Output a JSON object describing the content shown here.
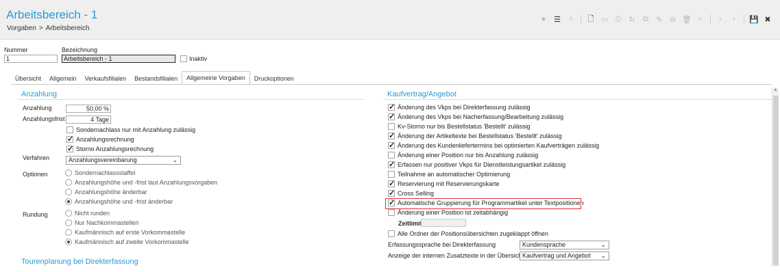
{
  "window": {
    "title": "Arbeitsbereich - 1"
  },
  "breadcrumb": [
    "Vorgaben",
    "Arbeitsbereich"
  ],
  "breadcrumb_sep": ">",
  "toolbar": {
    "icons": [
      "comment-icon",
      "list-icon",
      "pin-icon",
      "new-document-icon",
      "folder-icon",
      "print-icon",
      "refresh-icon",
      "copy-icon",
      "attach-icon",
      "stop-icon",
      "delete-icon",
      "search-icon",
      "prev-icon",
      "next-icon",
      "save-icon",
      "close-icon"
    ],
    "glyphs": [
      "●",
      "☰",
      "♀",
      "🗋",
      "▭",
      "⎙",
      "↻",
      "⧉",
      "✎",
      "⊖",
      "🗑",
      "⌕",
      "‹",
      "›",
      "💾",
      "✖"
    ]
  },
  "header_fields": {
    "nummer_label": "Nummer",
    "nummer_value": "1",
    "bezeichnung_label": "Bezeichnung",
    "bezeichnung_value": "Arbeitsbereich - 1",
    "inaktiv_label": "Inaktiv"
  },
  "tabs": [
    "Übersicht",
    "Allgemein",
    "Verkaufsfilialen",
    "Bestandsfilialen",
    "Allgemeine Vorgaben",
    "Druckoptionen"
  ],
  "active_tab": "Allgemeine Vorgaben",
  "anzahlung": {
    "title": "Anzahlung",
    "anzahlung_label": "Anzahlung",
    "anzahlung_value": "50,00 %",
    "frist_label": "Anzahlungsfrist",
    "frist_value": "4 Tage",
    "checks": [
      {
        "label": "Sondernachlass nur mit Anzahlung zulässig",
        "checked": false
      },
      {
        "label": "Anzahlungsrechnung",
        "checked": true
      },
      {
        "label": "Storno Anzahlungsrechnung",
        "checked": true
      }
    ],
    "verfahren_label": "Verfahren",
    "verfahren_value": "Anzahlungsvereinbarung",
    "optionen_label": "Optionen",
    "optionen": [
      {
        "label": "Sondernachlassstaffel",
        "selected": false
      },
      {
        "label": "Anzahlungshöhe und -frist laut Anzahlungsvorgaben",
        "selected": false
      },
      {
        "label": "Anzahlungshöhe änderbar",
        "selected": false
      },
      {
        "label": "Anzahlungshöhe und -frist änderbar",
        "selected": true
      }
    ],
    "rundung_label": "Rundung",
    "rundung": [
      {
        "label": "Nicht runden",
        "selected": false
      },
      {
        "label": "Nur Nachkommastellen",
        "selected": false
      },
      {
        "label": "Kaufmännisch auf erste Vorkommastelle",
        "selected": false
      },
      {
        "label": "Kaufmännisch auf zweite Vorkommastelle",
        "selected": true
      }
    ],
    "touren_title": "Tourenplanung bei Direkterfassung"
  },
  "kaufvertrag": {
    "title": "Kaufvertrag/Angebot",
    "items": [
      {
        "label": "Änderung des Vkps bei Direkterfassung zulässig",
        "checked": true
      },
      {
        "label": "Änderung des Vkps bei Nacherfassung/Bearbeitung zulässig",
        "checked": true
      },
      {
        "label": "Kv-Storno nur bis Bestellstatus 'Bestellt' zulässig",
        "checked": false
      },
      {
        "label": "Änderung der Artikeltexte bei Bestellstatus 'Bestellt' zulässig",
        "checked": true
      },
      {
        "label": "Änderung des Kundenliefertermins bei optimierten Kaufverträgen zulässig",
        "checked": true
      },
      {
        "label": "Änderung einer Position nur bis Anzahlung zulässig",
        "checked": false
      },
      {
        "label": "Erfassen nur positiver Vkps für Dienstleistungsartikel zulässig",
        "checked": true
      },
      {
        "label": "Teilnahme an automatischer Optimierung",
        "checked": false
      },
      {
        "label": "Reservierung mit Reservierungskarte",
        "checked": true
      },
      {
        "label": "Cross Selling",
        "checked": true
      },
      {
        "label": "Automatische Gruppierung für Programmartikel unter Textpositionen",
        "checked": true
      },
      {
        "label": "Änderung einer Position ist zeitabhängig",
        "checked": false
      }
    ],
    "zeitlimit_label": "Zeitlimit",
    "zeitlimit_value": "",
    "ordner_label": "Alle Ordner der Positionsübersichten zugeklappt öffnen",
    "ordner_checked": false,
    "sprache_label": "Erfassungssprache bei Direkterfassung",
    "sprache_value": "Kundensprache",
    "zusatz_label": "Anzeige der internen Zusatztexte in der Übersicht",
    "zusatz_value": "Kaufvertrag und Angebot"
  }
}
